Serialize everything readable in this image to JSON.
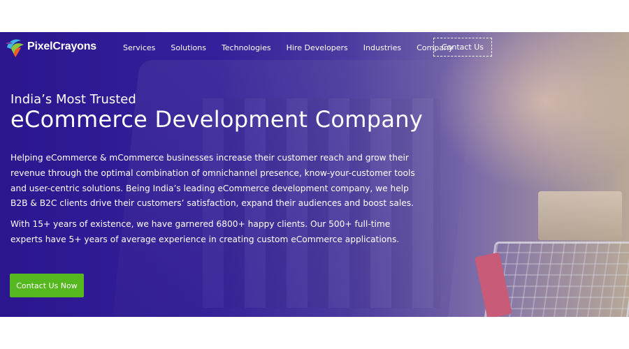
{
  "brand": {
    "logo_text": "PixelCrayons"
  },
  "nav": {
    "items": [
      {
        "label": "Services"
      },
      {
        "label": "Solutions"
      },
      {
        "label": "Technologies"
      },
      {
        "label": "Hire Developers"
      },
      {
        "label": "Industries"
      },
      {
        "label": "Company"
      }
    ],
    "contact_label": "Contact Us"
  },
  "hero": {
    "subtitle": "India’s Most Trusted",
    "title": "eCommerce Development Company",
    "paragraph1": "Helping eCommerce & mCommerce businesses increase their customer reach and grow their revenue through the optimal combination of omnichannel presence, know-your-customer tools and user-centric solutions. Being India’s leading eCommerce development company, we help B2B & B2C clients drive their customers’ satisfaction, expand their audiences and boost sales.",
    "paragraph2": "With 15+ years of existence, we have garnered 6800+ happy clients. Our 500+ full-time experts have 5+ years of average experience in creating custom eCommerce applications.",
    "cta_label": "Contact Us Now"
  },
  "colors": {
    "hero_bg": "#2b1690",
    "cta_green": "#56b81f",
    "text": "#ffffff"
  }
}
